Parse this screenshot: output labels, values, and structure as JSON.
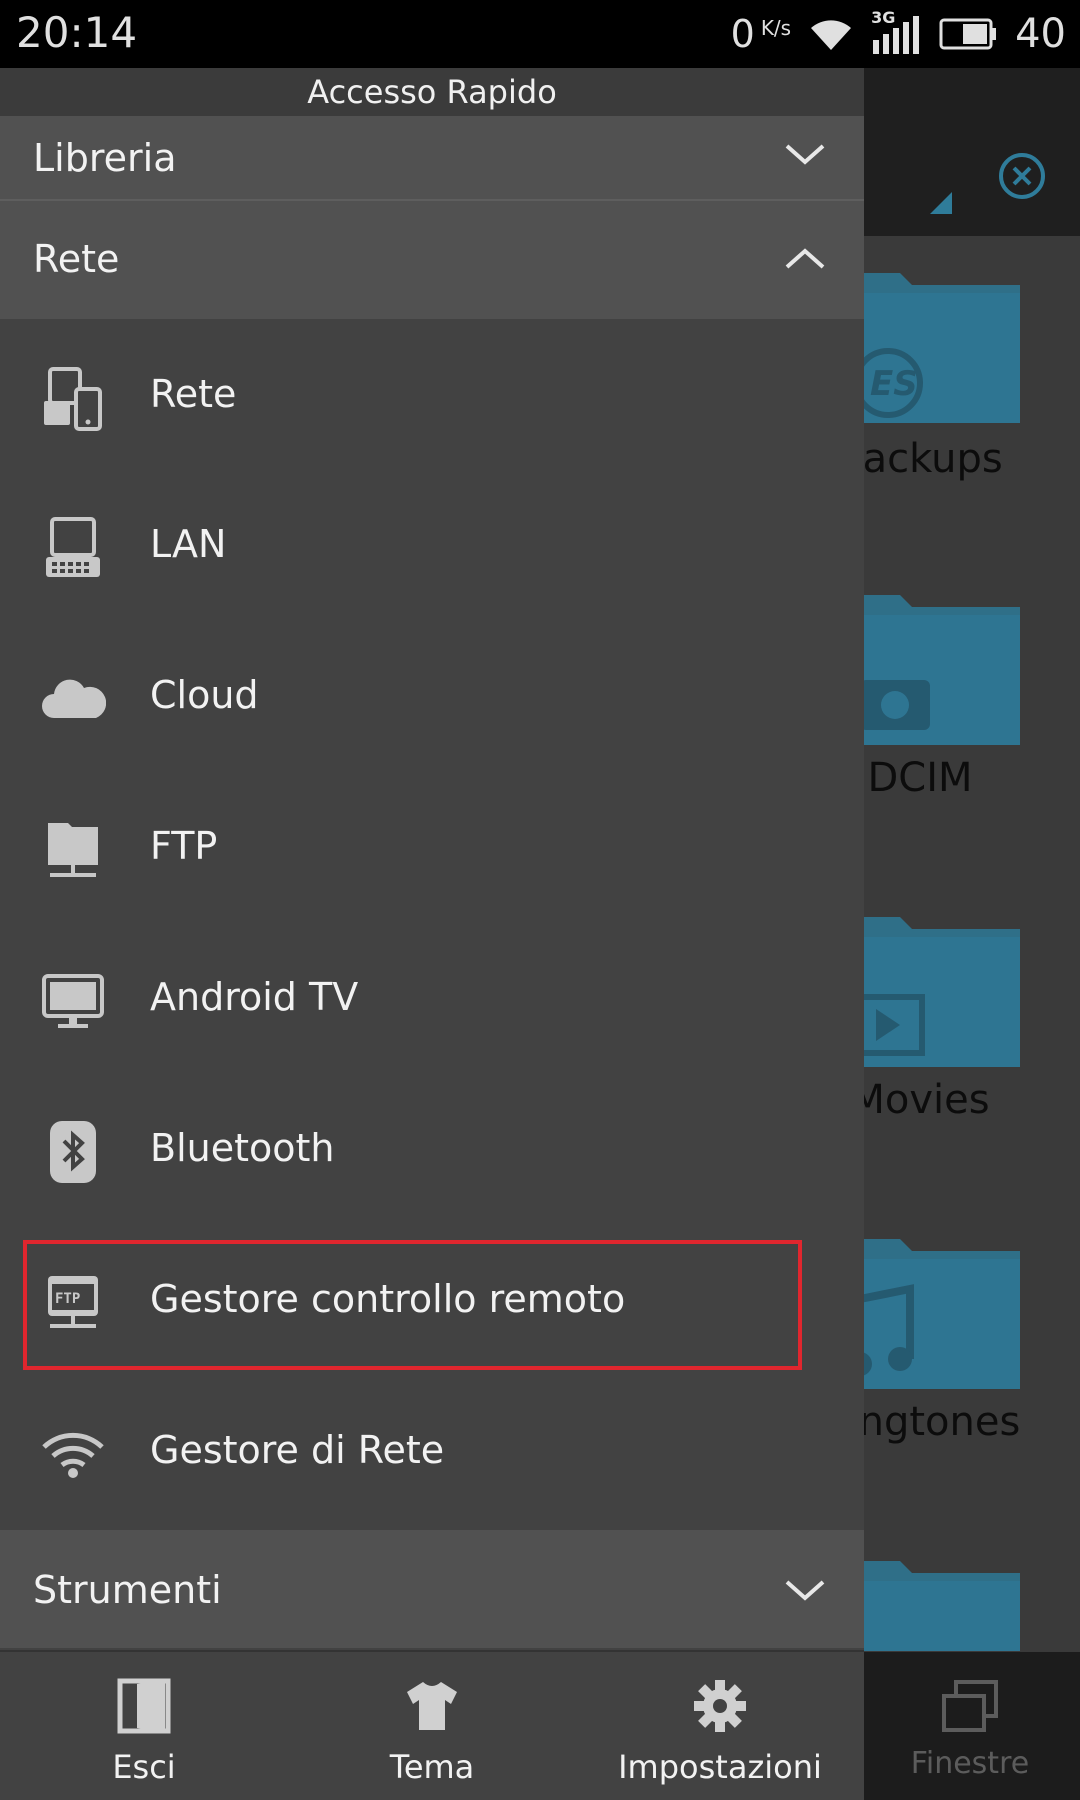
{
  "status_bar": {
    "time": "20:14",
    "speed_value": "0",
    "speed_unit": "K/s",
    "network_type": "3G",
    "battery_level": "40"
  },
  "drawer": {
    "title": "Accesso Rapido",
    "sections": {
      "libreria": {
        "label": "Libreria",
        "expanded": false
      },
      "rete": {
        "label": "Rete",
        "expanded": true
      },
      "strumenti": {
        "label": "Strumenti",
        "expanded": false
      }
    },
    "rete_items": [
      {
        "label": "Rete",
        "icon": "network-devices-icon"
      },
      {
        "label": "LAN",
        "icon": "lan-computer-icon"
      },
      {
        "label": "Cloud",
        "icon": "cloud-icon"
      },
      {
        "label": "FTP",
        "icon": "ftp-server-icon"
      },
      {
        "label": "Android TV",
        "icon": "tv-monitor-icon"
      },
      {
        "label": "Bluetooth",
        "icon": "bluetooth-icon"
      },
      {
        "label": "Gestore controllo remoto",
        "icon": "remote-ftp-icon",
        "highlighted": true
      },
      {
        "label": "Gestore di Rete",
        "icon": "wifi-manager-icon"
      }
    ],
    "bottom_bar": {
      "exit": "Esci",
      "theme": "Tema",
      "settings": "Impostazioni"
    }
  },
  "background_app": {
    "folders": [
      "backups",
      "DCIM",
      "Movies",
      "Ringtones"
    ],
    "windows_label": "Finestre",
    "accent_color": "#2f7c9a"
  },
  "colors": {
    "drawer_bg": "#424242",
    "section_header_bg": "#515151",
    "highlight_border": "#e0262e"
  }
}
